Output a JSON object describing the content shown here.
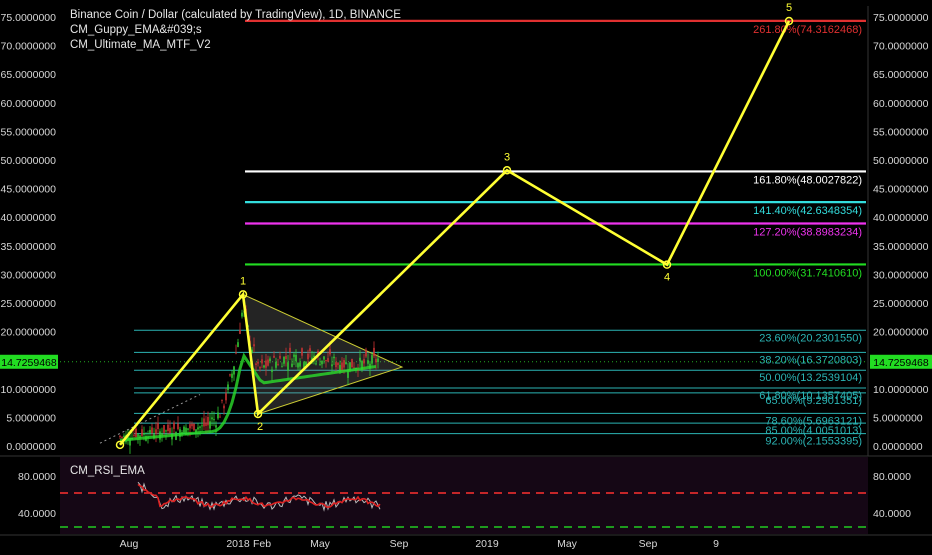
{
  "title": "Binance Coin / Dollar (calculated by TradingView), 1D, BINANCE",
  "indicators": [
    "CM_Guppy_EMA&#039;s",
    "CM_Ultimate_MA_MTF_V2"
  ],
  "rsi_label": "CM_RSI_EMA",
  "current_price": "14.7259468",
  "colors": {
    "background": "#000000",
    "wave": "#ffff33",
    "price_tag": "#22dd22",
    "rsi_upper": "#ff3030",
    "rsi_lower": "#22cc22"
  },
  "chart_data": [
    {
      "type": "line",
      "scale": "linear",
      "ylim": [
        0,
        76
      ],
      "x_ticks": [
        "Aug",
        "2018",
        "Feb",
        "May",
        "Sep",
        "2019",
        "May",
        "Sep",
        "9"
      ],
      "y_ticks": [
        "0.0000000",
        "5.0000000",
        "10.0000000",
        "15.0000000",
        "20.0000000",
        "25.0000000",
        "30.0000000",
        "35.0000000",
        "40.0000000",
        "45.0000000",
        "50.0000000",
        "55.0000000",
        "60.0000000",
        "65.0000000",
        "70.0000000",
        "75.0000000"
      ],
      "series": [
        {
          "type": "line",
          "color": "#ffff33",
          "points": [
            {
              "label": "",
              "y": 0.2
            },
            {
              "label": "1",
              "y": 26.5
            },
            {
              "label": "2",
              "y": 5.6
            },
            {
              "label": "3",
              "y": 48.2
            },
            {
              "label": "4",
              "y": 31.7
            },
            {
              "label": "5",
              "y": 74.3
            }
          ]
        }
      ],
      "fib_levels": [
        {
          "label": "261.80%(74.3162468)",
          "value": 74.3162468,
          "color": "#e03030"
        },
        {
          "label": "161.80%(48.0027822)",
          "value": 48.0027822,
          "color": "#ffffff"
        },
        {
          "label": "141.40%(42.6348354)",
          "value": 42.6348354,
          "color": "#33dddd"
        },
        {
          "label": "127.20%(38.8983234)",
          "value": 38.8983234,
          "color": "#ee33ee"
        },
        {
          "label": "100.00%(31.7410610)",
          "value": 31.741061,
          "color": "#22dd22"
        },
        {
          "label": "23.60%(20.2301550)",
          "value": 20.230155,
          "color": "#2bb4b4"
        },
        {
          "label": "38.20%(16.3720803)",
          "value": 16.3720803,
          "color": "#2bb4b4"
        },
        {
          "label": "50.00%(13.2539104)",
          "value": 13.2539104,
          "color": "#2bb4b4"
        },
        {
          "label": "61.80%(10.1357405)",
          "value": 10.1357405,
          "color": "#2bb4b4"
        },
        {
          "label": "65.00%(9.2901351)",
          "value": 9.2901351,
          "color": "#2bb4b4"
        },
        {
          "label": "78.60%(5.6963121)",
          "value": 5.6963121,
          "color": "#2bb4b4"
        },
        {
          "label": "85.00%(4.0051013)",
          "value": 4.0051013,
          "color": "#2bb4b4"
        },
        {
          "label": "92.00%(2.1553395)",
          "value": 2.1553395,
          "color": "#2bb4b4"
        }
      ],
      "price_line": 14.7259468
    },
    {
      "type": "line",
      "title": "CM_RSI_EMA",
      "y_ticks": [
        "80.0000",
        "40.0000"
      ],
      "ylim": [
        30,
        90
      ],
      "levels": [
        {
          "value": 70,
          "color": "#ff3030"
        },
        {
          "value": 30,
          "color": "#22cc22"
        }
      ]
    }
  ]
}
